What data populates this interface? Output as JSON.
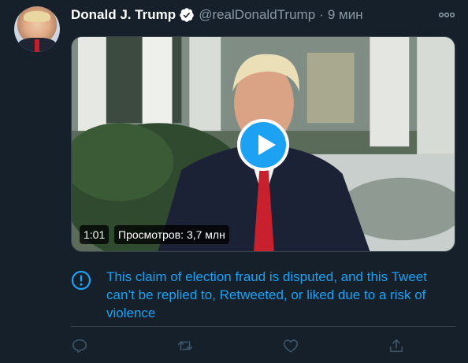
{
  "author": {
    "name": "Donald J. Trump",
    "handle": "@realDonaldTrump",
    "separator": "·",
    "time": "9 мин"
  },
  "media": {
    "duration": "1:01",
    "views": "Просмотров: 3,7 млн"
  },
  "notice": {
    "text": "This claim of election fraud is disputed, and this Tweet can’t be replied to, Retweeted, or liked due to a risk of violence"
  },
  "icons": {
    "verified": "verified-badge-icon",
    "more": "more-options-icon",
    "play": "play-icon",
    "info": "exclamation-circle-icon",
    "reply": "reply-icon",
    "retweet": "retweet-icon",
    "like": "heart-icon",
    "share": "share-icon"
  },
  "colors": {
    "background": "#15202b",
    "accent": "#1da1f2",
    "secondary_text": "#8899a6",
    "divider": "#38444d",
    "action_icon_disabled": "#3d5466"
  }
}
